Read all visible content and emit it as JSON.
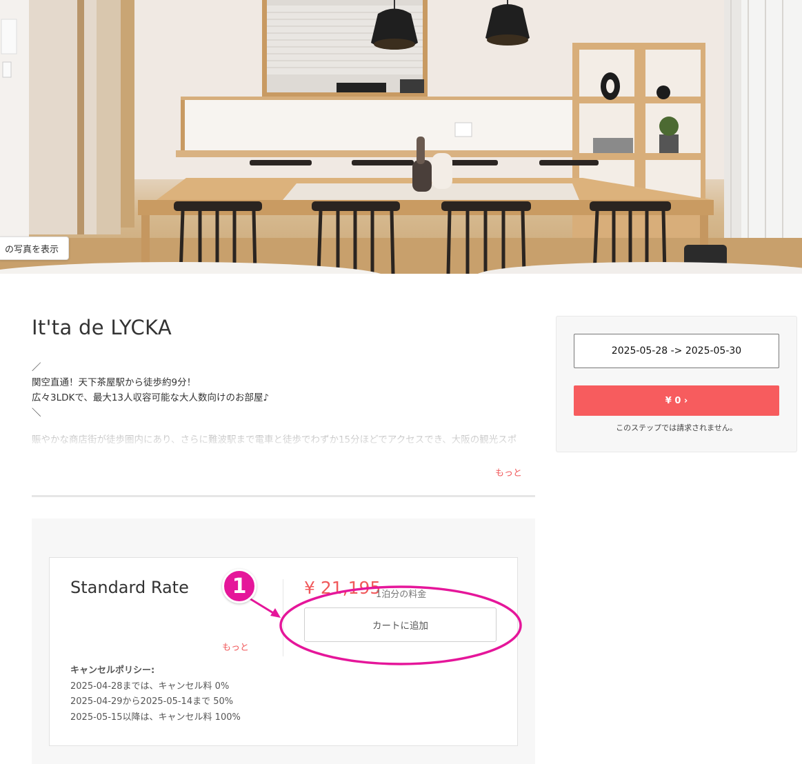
{
  "hero": {
    "photos_button_label": "の写真を表示"
  },
  "listing": {
    "title": "It'ta de LYCKA",
    "description_lines": [
      "／",
      "関空直通！天下茶屋駅から徒歩約9分！",
      "広々3LDKで、最大13人収容可能な大人数向けのお部屋♪",
      "＼"
    ],
    "description_faded": "賑やかな商店街が徒歩圏内にあり、さらに難波駅まで電車と徒歩でわずか15分ほどでアクセスでき、大阪の観光スポ",
    "more_label": "もっと"
  },
  "rate": {
    "name": "Standard Rate",
    "more_label": "もっと",
    "price": "¥ 21,195",
    "price_unit": "1泊分の料金",
    "add_to_cart_label": "カートに追加",
    "cancellation_title": "キャンセルポリシー:",
    "cancellation_lines": [
      "2025-04-28までは、キャンセル料 0%",
      "2025-04-29から2025-05-14まで 50%",
      "2025-05-15以降は、キャンセル料 100%"
    ]
  },
  "booking": {
    "date_range": "2025-05-28 -> 2025-05-30",
    "total_label": "¥ 0 ›",
    "note": "このステップでは請求されません。"
  },
  "annotation": {
    "step_number": "1",
    "color": "#e5169a"
  },
  "colors": {
    "accent": "#f75c5e",
    "link": "#f0585a",
    "annotation": "#e5169a"
  }
}
